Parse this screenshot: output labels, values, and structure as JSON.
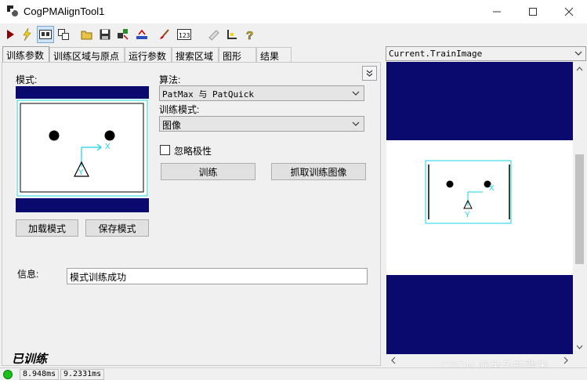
{
  "window": {
    "title": "CogPMAlignTool1"
  },
  "tabs": [
    {
      "label": "训练参数"
    },
    {
      "label": "训练区域与原点"
    },
    {
      "label": "运行参数"
    },
    {
      "label": "搜索区域"
    },
    {
      "label": "图形"
    },
    {
      "label": "结果"
    }
  ],
  "train_params": {
    "pattern_label": "模式:",
    "algorithm_label": "算法:",
    "algorithm_value": "PatMax 与 PatQuick",
    "train_mode_label": "训练模式:",
    "train_mode_value": "图像",
    "ignore_polarity_label": "忽略极性",
    "ignore_polarity_checked": false,
    "train_button": "训练",
    "grab_button": "抓取训练图像",
    "load_button": "加载模式",
    "save_button": "保存模式",
    "info_label": "信息:",
    "info_value": "模式训练成功",
    "status_trained": "已训练"
  },
  "image_view": {
    "selected": "Current.TrainImage",
    "axis_x": "X",
    "axis_y": "Y"
  },
  "statusbar": {
    "time1": "8.948ms",
    "time2": "9.2331ms"
  },
  "watermark": "CSDN @金色的费米",
  "colors": {
    "background_blue": "#0a0a6e",
    "axis_cyan": "#19d3e6",
    "status_green": "#19c219"
  }
}
